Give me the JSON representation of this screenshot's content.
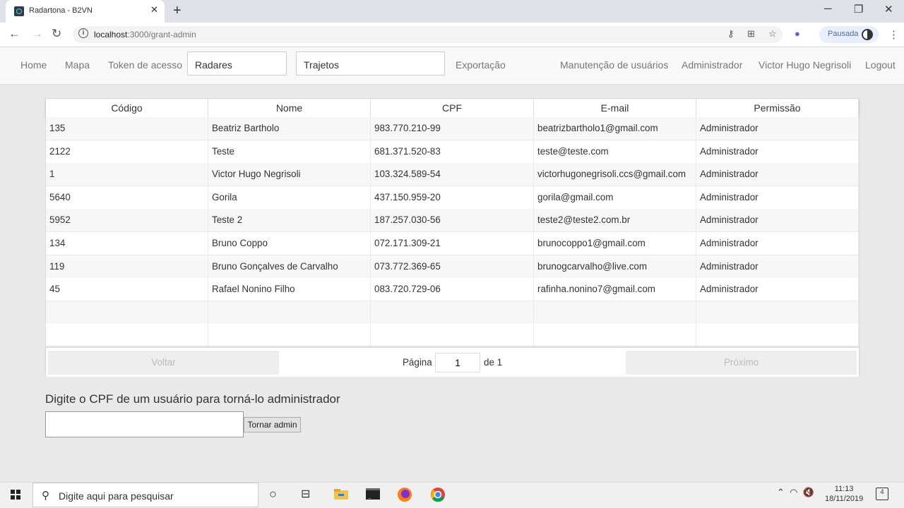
{
  "browser": {
    "tab_title": "Radartona - B2VN",
    "url_host": "localhost",
    "url_path": ":3000/grant-admin",
    "profile_status": "Pausada"
  },
  "nav": {
    "home": "Home",
    "mapa": "Mapa",
    "token": "Token de acesso",
    "radares": "Radares",
    "trajetos": "Trajetos",
    "exportacao": "Exportação",
    "manutencao": "Manutenção de usuários",
    "administrador": "Administrador",
    "user": "Victor Hugo Negrisoli",
    "logout": "Logout"
  },
  "table": {
    "columns": [
      "Código",
      "Nome",
      "CPF",
      "E-mail",
      "Permissão"
    ],
    "rows": [
      [
        "135",
        "Beatriz Bartholo",
        "983.770.210-99",
        "beatrizbartholo1@gmail.com",
        "Administrador"
      ],
      [
        "2122",
        "Teste",
        "681.371.520-83",
        "teste@teste.com",
        "Administrador"
      ],
      [
        "1",
        "Victor Hugo Negrisoli",
        "103.324.589-54",
        "victorhugonegrisoli.ccs@gmail.com",
        "Administrador"
      ],
      [
        "5640",
        "Gorila",
        "437.150.959-20",
        "gorila@gmail.com",
        "Administrador"
      ],
      [
        "5952",
        "Teste 2",
        "187.257.030-56",
        "teste2@teste2.com.br",
        "Administrador"
      ],
      [
        "134",
        "Bruno Coppo",
        "072.171.309-21",
        "brunocoppo1@gmail.com",
        "Administrador"
      ],
      [
        "119",
        "Bruno Gonçalves de Carvalho",
        "073.772.369-65",
        "brunogcarvalho@live.com",
        "Administrador"
      ],
      [
        "45",
        "Rafael Nonino Filho",
        "083.720.729-06",
        "rafinha.nonino7@gmail.com",
        "Administrador"
      ],
      [
        "",
        "",
        "",
        "",
        ""
      ],
      [
        "",
        "",
        "",
        "",
        ""
      ]
    ]
  },
  "pager": {
    "prev": "Voltar",
    "page_label": "Página",
    "page_value": "1",
    "page_of": "de 1",
    "next": "Próximo"
  },
  "form": {
    "title": "Digite o CPF de um usuário para torná-lo administrador",
    "input_value": "",
    "button": "Tornar admin"
  },
  "taskbar": {
    "search_placeholder": "Digite aqui para pesquisar",
    "time": "11:13",
    "date": "18/11/2019",
    "notifications": "4"
  }
}
